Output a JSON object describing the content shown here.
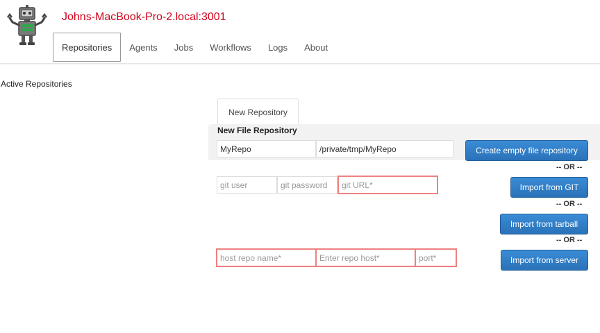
{
  "header": {
    "host_title": "Johns-MacBook-Pro-2.local:3001",
    "logo_icon": "robot-icon"
  },
  "nav": {
    "items": [
      {
        "label": "Repositories",
        "active": true
      },
      {
        "label": "Agents"
      },
      {
        "label": "Jobs"
      },
      {
        "label": "Workflows"
      },
      {
        "label": "Logs"
      },
      {
        "label": "About"
      }
    ]
  },
  "main": {
    "section_label": "Active Repositories",
    "tab_label": "New Repository",
    "panel_title": "New File Repository",
    "file_repo": {
      "name_value": "MyRepo",
      "path_value": "/private/tmp/MyRepo",
      "create_button": "Create empty file repository"
    },
    "or_label": "-- OR --",
    "git": {
      "user_placeholder": "git user",
      "password_placeholder": "git password",
      "url_placeholder": "git URL*",
      "import_button": "Import from GIT"
    },
    "tarball": {
      "import_button": "Import from tarball"
    },
    "server": {
      "host_repo_placeholder": "host repo name*",
      "host_placeholder": "Enter repo host*",
      "port_placeholder": "port*",
      "import_button": "Import from server"
    }
  },
  "colors": {
    "host_title": "#d0021b",
    "button_blue": "#2f7cc4",
    "required_border": "#f08080"
  }
}
